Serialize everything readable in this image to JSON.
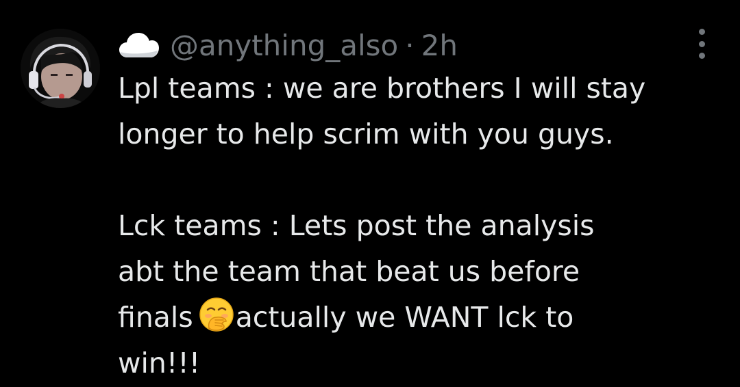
{
  "tweet": {
    "author": {
      "badge_icon": "cloud-icon",
      "handle": "@anything_also",
      "separator": "·",
      "time": "2h"
    },
    "menu_icon": "more-vertical-icon",
    "text": {
      "line1": "Lpl teams : we are brothers I will stay",
      "line2": "longer to help scrim with you guys.",
      "line3": "Lck teams : Lets post the analysis",
      "line4": "abt the team that beat us before",
      "line5_before": "finals",
      "line5_emoji": "face-with-hand-over-mouth-emoji",
      "line5_after": "actually we WANT lck to",
      "line6": "win!!!"
    }
  },
  "colors": {
    "background": "#000000",
    "text": "#e7e9ea",
    "secondary": "#71767b"
  }
}
